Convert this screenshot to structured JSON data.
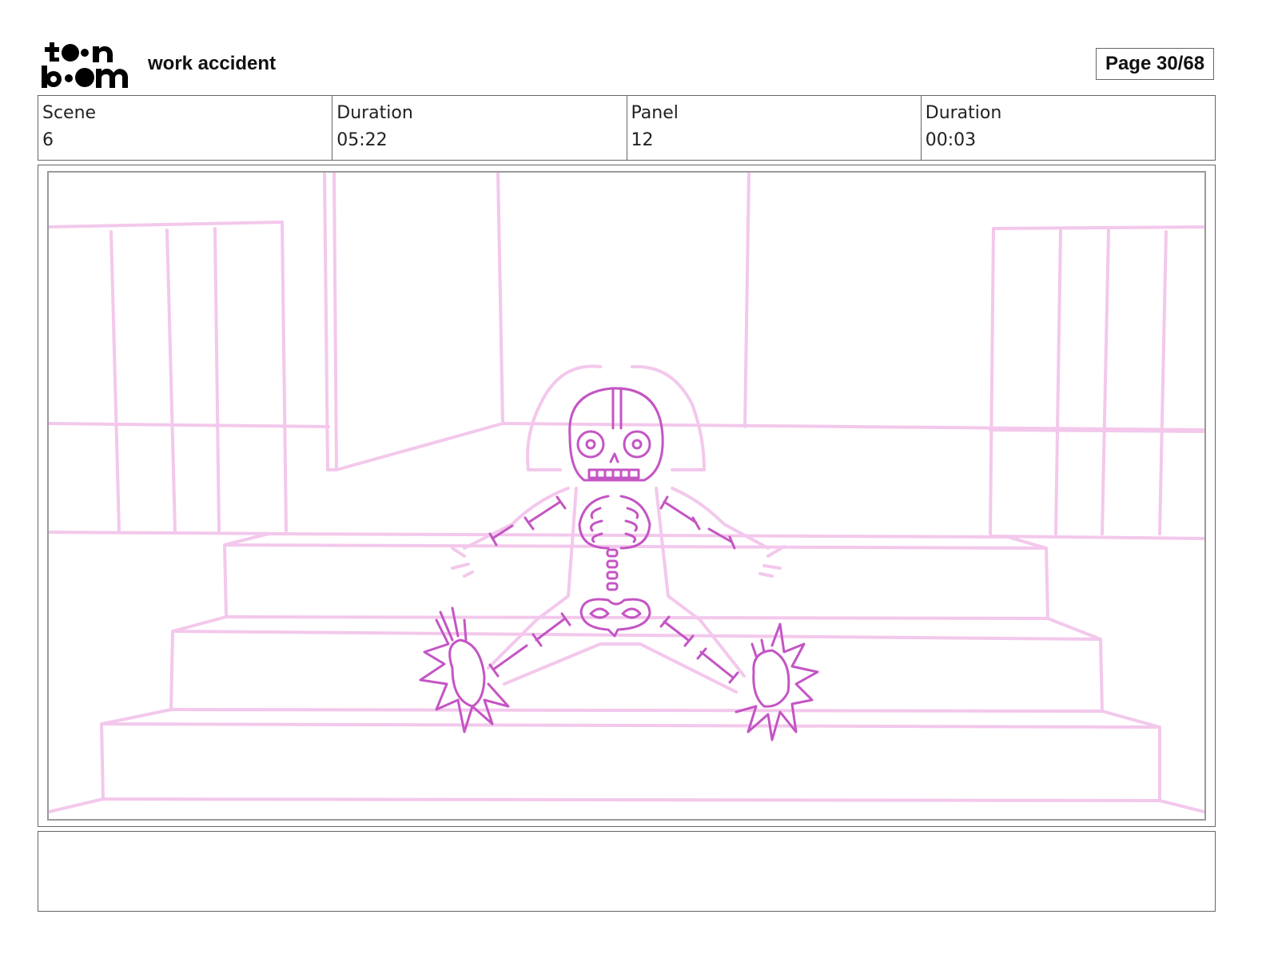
{
  "header": {
    "logo_name": "toon boom",
    "project_title": "work accident",
    "page_label": "Page 30/68"
  },
  "info": [
    {
      "label": "Scene",
      "value": "6"
    },
    {
      "label": "Duration",
      "value": "05:22"
    },
    {
      "label": "Panel",
      "value": "12"
    },
    {
      "label": "Duration",
      "value": "00:03"
    }
  ],
  "panel": {
    "sketch_background_color": "#f3c8ec",
    "sketch_character_color": "#c455c4"
  },
  "notes": {
    "text": ""
  }
}
